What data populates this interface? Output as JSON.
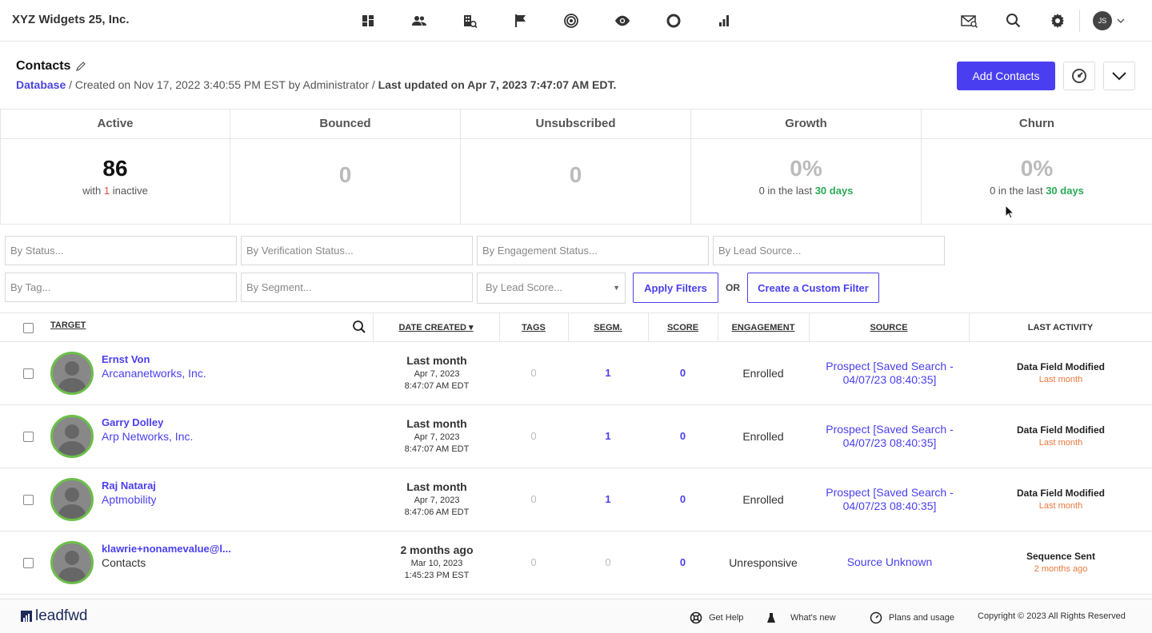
{
  "topbar": {
    "company": "XYZ Widgets 25, Inc.",
    "nav_icons": [
      "dashboard-icon",
      "contacts-icon",
      "companies-icon",
      "campaigns-flag-icon",
      "target-icon",
      "visitors-eye-icon",
      "circle-icon",
      "reports-icon"
    ],
    "avatar_initials": "JS"
  },
  "header": {
    "title": "Contacts",
    "database_link": "Database",
    "created_text": " / Created on Nov 17, 2022 3:40:55 PM EST by Administrator / ",
    "updated_text": "Last updated on Apr 7, 2023 7:47:07 AM EDT.",
    "add_button": "Add Contacts"
  },
  "stats": [
    {
      "label": "Active",
      "value": "86",
      "sub_pre": "with ",
      "sub_num": "1",
      "sub_post": " inactive"
    },
    {
      "label": "Bounced",
      "value": "0"
    },
    {
      "label": "Unsubscribed",
      "value": "0"
    },
    {
      "label": "Growth",
      "value": "0%",
      "sub_pre": "0 in the last ",
      "sub_num": "30 days"
    },
    {
      "label": "Churn",
      "value": "0%",
      "sub_pre": "0 in the last ",
      "sub_num": "30 days"
    }
  ],
  "filters": {
    "status": "By Status...",
    "verification": "By Verification Status...",
    "engagement": "By Engagement Status...",
    "lead_source": "By Lead Source...",
    "tag": "By Tag...",
    "segment": "By Segment...",
    "lead_score": "By Lead Score...",
    "apply": "Apply Filters",
    "or": "OR",
    "custom": "Create a Custom Filter"
  },
  "table": {
    "headers": {
      "target": "TARGET",
      "date_created": "DATE CREATED ▾",
      "tags": "TAGS",
      "segm": "SEGM.",
      "score": "SCORE",
      "engagement": "ENGAGEMENT",
      "source": "SOURCE",
      "last_activity": "LAST ACTIVITY"
    },
    "rows": [
      {
        "name": "Ernst Von",
        "company": "Arcananetworks, Inc.",
        "rel": "Last month",
        "date": "Apr 7, 2023",
        "time": "8:47:07 AM EDT",
        "tags": "0",
        "segm": "1",
        "score": "0",
        "engagement": "Enrolled",
        "source1": "Prospect [Saved Search -",
        "source2": "04/07/23 08:40:35]",
        "activity": "Data Field Modified",
        "activity_when": "Last month"
      },
      {
        "name": "Garry Dolley",
        "company": "Arp Networks, Inc.",
        "rel": "Last month",
        "date": "Apr 7, 2023",
        "time": "8:47:07 AM EDT",
        "tags": "0",
        "segm": "1",
        "score": "0",
        "engagement": "Enrolled",
        "source1": "Prospect [Saved Search -",
        "source2": "04/07/23 08:40:35]",
        "activity": "Data Field Modified",
        "activity_when": "Last month"
      },
      {
        "name": "Raj Nataraj",
        "company": "Aptmobility",
        "rel": "Last month",
        "date": "Apr 7, 2023",
        "time": "8:47:06 AM EDT",
        "tags": "0",
        "segm": "1",
        "score": "0",
        "engagement": "Enrolled",
        "source1": "Prospect [Saved Search -",
        "source2": "04/07/23 08:40:35]",
        "activity": "Data Field Modified",
        "activity_when": "Last month"
      },
      {
        "name": "klawrie+nonamevalue@l...",
        "company": "Contacts",
        "rel": "2 months ago",
        "date": "Mar 10, 2023",
        "time": "1:45:23 PM EST",
        "tags": "0",
        "segm": "0",
        "score": "0",
        "engagement": "Unresponsive",
        "source1": "Source Unknown",
        "source2": "",
        "activity": "Sequence Sent",
        "activity_when": "2 months ago"
      }
    ]
  },
  "footer": {
    "logo": "leadfwd",
    "help": "Get Help",
    "whats_new": "What's new",
    "plans": "Plans and usage",
    "copyright": "Copyright © 2023 All Rights Reserved"
  }
}
